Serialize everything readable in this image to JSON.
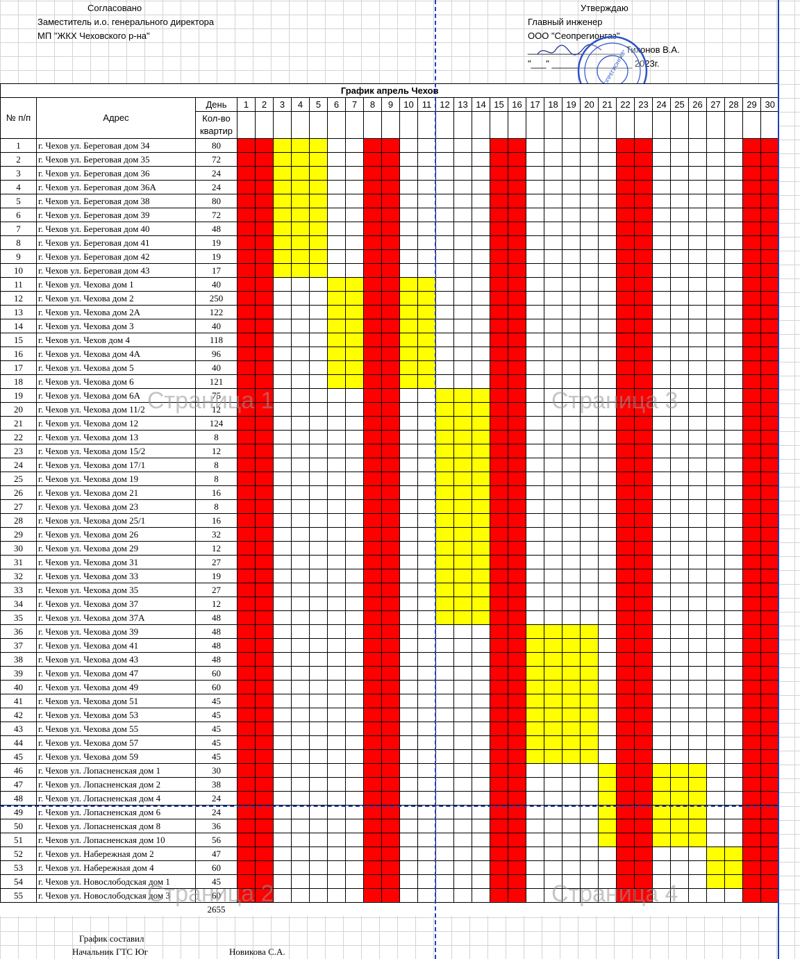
{
  "header": {
    "left_title": "Согласовано",
    "left_line1": "Заместитель и.о. генерального директора",
    "left_line2": "МП \"ЖКХ Чеховского р-на\"",
    "right_title": "Утверждаю",
    "right_line1": "Главный инженер",
    "right_line2": "ООО \"Сеопрегионгаз\"",
    "right_sign_line": "___________________  Тихонов В.А.",
    "right_date_line": "\"___\" ________________ 2023г.",
    "stamp_text": "\"СЕОПРЕГИОНГАЗ\""
  },
  "table": {
    "title": "График апрель Чехов",
    "col_num": "№ п/п",
    "col_addr": "Адрес",
    "col_day": "День",
    "col_count": "Кол-во квартир",
    "days": [
      "1",
      "2",
      "3",
      "4",
      "5",
      "6",
      "7",
      "8",
      "9",
      "10",
      "11",
      "12",
      "13",
      "14",
      "15",
      "16",
      "17",
      "18",
      "19",
      "20",
      "21",
      "22",
      "23",
      "24",
      "25",
      "26",
      "27",
      "28",
      "29",
      "30"
    ],
    "rows": [
      {
        "n": "1",
        "addr": "г. Чехов ул. Береговая дом 34",
        "q": "80",
        "y": [
          3,
          5
        ]
      },
      {
        "n": "2",
        "addr": "г. Чехов ул. Береговая дом 35",
        "q": "72",
        "y": [
          3,
          5
        ]
      },
      {
        "n": "3",
        "addr": "г. Чехов ул. Береговая дом 36",
        "q": "24",
        "y": [
          3,
          5
        ]
      },
      {
        "n": "4",
        "addr": "г. Чехов ул. Береговая дом 36А",
        "q": "24",
        "y": [
          3,
          5
        ]
      },
      {
        "n": "5",
        "addr": "г. Чехов ул. Береговая дом 38",
        "q": "80",
        "y": [
          3,
          5
        ]
      },
      {
        "n": "6",
        "addr": "г. Чехов ул. Береговая дом 39",
        "q": "72",
        "y": [
          3,
          5
        ]
      },
      {
        "n": "7",
        "addr": "г. Чехов ул. Береговая дом 40",
        "q": "48",
        "y": [
          3,
          5
        ]
      },
      {
        "n": "8",
        "addr": "г. Чехов ул. Береговая дом 41",
        "q": "19",
        "y": [
          3,
          5
        ]
      },
      {
        "n": "9",
        "addr": "г. Чехов ул. Береговая дом 42",
        "q": "19",
        "y": [
          3,
          5
        ]
      },
      {
        "n": "10",
        "addr": "г. Чехов ул. Береговая дом 43",
        "q": "17",
        "y": [
          3,
          5
        ]
      },
      {
        "n": "11",
        "addr": "г. Чехов ул. Чехова дом 1",
        "q": "40",
        "y": [
          6,
          7,
          10,
          11
        ]
      },
      {
        "n": "12",
        "addr": "г. Чехов ул. Чехова дом 2",
        "q": "250",
        "y": [
          6,
          7,
          10,
          11
        ]
      },
      {
        "n": "13",
        "addr": "г. Чехов ул. Чехова дом 2А",
        "q": "122",
        "y": [
          6,
          7,
          10,
          11
        ]
      },
      {
        "n": "14",
        "addr": "г. Чехов ул. Чехова дом 3",
        "q": "40",
        "y": [
          6,
          7,
          10,
          11
        ]
      },
      {
        "n": "15",
        "addr": "г. Чехов ул. Чехов дом 4",
        "q": "118",
        "y": [
          6,
          7,
          10,
          11
        ]
      },
      {
        "n": "16",
        "addr": "г. Чехов ул. Чехова дом 4А",
        "q": "96",
        "y": [
          6,
          7,
          10,
          11
        ]
      },
      {
        "n": "17",
        "addr": "г. Чехов ул. Чехова дом 5",
        "q": "40",
        "y": [
          6,
          7,
          10,
          11
        ]
      },
      {
        "n": "18",
        "addr": "г. Чехов ул. Чехова дом 6",
        "q": "121",
        "y": [
          6,
          7,
          10,
          11
        ]
      },
      {
        "n": "19",
        "addr": "г. Чехов ул. Чехова дом 6А",
        "q": "75",
        "y": [
          12,
          14
        ]
      },
      {
        "n": "20",
        "addr": "г. Чехов ул. Чехова дом 11/2",
        "q": "12",
        "y": [
          12,
          14
        ]
      },
      {
        "n": "21",
        "addr": "г. Чехов ул. Чехова дом 12",
        "q": "124",
        "y": [
          12,
          14
        ]
      },
      {
        "n": "22",
        "addr": "г. Чехов ул. Чехова дом 13",
        "q": "8",
        "y": [
          12,
          14
        ]
      },
      {
        "n": "23",
        "addr": "г. Чехов ул. Чехова дом 15/2",
        "q": "12",
        "y": [
          12,
          14
        ]
      },
      {
        "n": "24",
        "addr": "г. Чехов ул. Чехова дом 17/1",
        "q": "8",
        "y": [
          12,
          14
        ]
      },
      {
        "n": "25",
        "addr": "г. Чехов ул. Чехова дом 19",
        "q": "8",
        "y": [
          12,
          14
        ]
      },
      {
        "n": "26",
        "addr": "г. Чехов ул. Чехова дом 21",
        "q": "16",
        "y": [
          12,
          14
        ]
      },
      {
        "n": "27",
        "addr": "г. Чехов ул. Чехова дом 23",
        "q": "8",
        "y": [
          12,
          14
        ]
      },
      {
        "n": "28",
        "addr": "г. Чехов ул. Чехова дом 25/1",
        "q": "16",
        "y": [
          12,
          14
        ]
      },
      {
        "n": "29",
        "addr": "г. Чехов ул. Чехова дом 26",
        "q": "32",
        "y": [
          12,
          14
        ]
      },
      {
        "n": "30",
        "addr": "г. Чехов ул. Чехова дом 29",
        "q": "12",
        "y": [
          12,
          14
        ]
      },
      {
        "n": "31",
        "addr": "г. Чехов ул. Чехова дом 31",
        "q": "27",
        "y": [
          12,
          14
        ]
      },
      {
        "n": "32",
        "addr": "г. Чехов ул. Чехова дом 33",
        "q": "19",
        "y": [
          12,
          14
        ]
      },
      {
        "n": "33",
        "addr": "г. Чехов ул. Чехова дом 35",
        "q": "27",
        "y": [
          12,
          14
        ]
      },
      {
        "n": "34",
        "addr": "г. Чехов ул. Чехова дом 37",
        "q": "12",
        "y": [
          12,
          14
        ]
      },
      {
        "n": "35",
        "addr": "г. Чехов ул. Чехова дом 37А",
        "q": "48",
        "y": [
          12,
          14
        ]
      },
      {
        "n": "36",
        "addr": "г. Чехов ул. Чехова дом 39",
        "q": "48",
        "y": [
          17,
          20
        ]
      },
      {
        "n": "37",
        "addr": "г. Чехов ул. Чехова дом 41",
        "q": "48",
        "y": [
          17,
          20
        ]
      },
      {
        "n": "38",
        "addr": "г. Чехов ул. Чехова дом 43",
        "q": "48",
        "y": [
          17,
          20
        ]
      },
      {
        "n": "39",
        "addr": "г. Чехов ул. Чехова дом 47",
        "q": "60",
        "y": [
          17,
          20
        ]
      },
      {
        "n": "40",
        "addr": "г. Чехов ул. Чехова дом 49",
        "q": "60",
        "y": [
          17,
          20
        ]
      },
      {
        "n": "41",
        "addr": "г. Чехов ул. Чехова дом 51",
        "q": "45",
        "y": [
          17,
          20
        ]
      },
      {
        "n": "42",
        "addr": "г. Чехов ул. Чехова дом 53",
        "q": "45",
        "y": [
          17,
          20
        ]
      },
      {
        "n": "43",
        "addr": "г. Чехов ул. Чехова дом 55",
        "q": "45",
        "y": [
          17,
          20
        ]
      },
      {
        "n": "44",
        "addr": "г. Чехов ул. Чехова дом 57",
        "q": "45",
        "y": [
          17,
          20
        ]
      },
      {
        "n": "45",
        "addr": "г. Чехов ул. Чехова дом 59",
        "q": "45",
        "y": [
          17,
          20
        ]
      },
      {
        "n": "46",
        "addr": "г. Чехов ул. Лопасненская дом 1",
        "q": "30",
        "y": [
          21,
          24,
          25,
          26
        ]
      },
      {
        "n": "47",
        "addr": "г. Чехов ул. Лопасненская дом 2",
        "q": "38",
        "y": [
          21,
          24,
          25,
          26
        ]
      },
      {
        "n": "48",
        "addr": "г. Чехов ул. Лопасненская дом 4",
        "q": "24",
        "y": [
          21,
          24,
          25,
          26
        ]
      },
      {
        "n": "49",
        "addr": "г. Чехов ул. Лопасненская дом 6",
        "q": "24",
        "y": [
          21,
          24,
          25,
          26
        ]
      },
      {
        "n": "50",
        "addr": "г. Чехов ул. Лопасненская дом 8",
        "q": "36",
        "y": [
          21,
          24,
          25,
          26
        ]
      },
      {
        "n": "51",
        "addr": "г. Чехов ул. Лопасненская дом 10",
        "q": "56",
        "y": [
          21,
          24,
          25,
          26
        ]
      },
      {
        "n": "52",
        "addr": "г. Чехов ул. Набережная дом 2",
        "q": "47",
        "y": [
          27,
          28
        ]
      },
      {
        "n": "53",
        "addr": "г. Чехов ул. Набережная дом 4",
        "q": "60",
        "y": [
          27,
          28
        ]
      },
      {
        "n": "54",
        "addr": "г. Чехов ул. Новослободская дом 1",
        "q": "45",
        "y": [
          27,
          28
        ]
      },
      {
        "n": "55",
        "addr": "г. Чехов ул. Новослободская дом 3",
        "q": "60",
        "y": []
      }
    ],
    "red_days": [
      1,
      2,
      8,
      9,
      15,
      16,
      22,
      23,
      29,
      30
    ],
    "total": "2655"
  },
  "page_marks": [
    "Страница 1",
    "Страница 2",
    "Страница 3",
    "Страница 4"
  ],
  "footer": {
    "line1": "График составил",
    "line2": "Начальник ГТС Юг",
    "name": "Новикова С.А."
  },
  "colors": {
    "weekend": "#ff0000",
    "work": "#ffff00",
    "page_break": "#1f3fbf"
  }
}
